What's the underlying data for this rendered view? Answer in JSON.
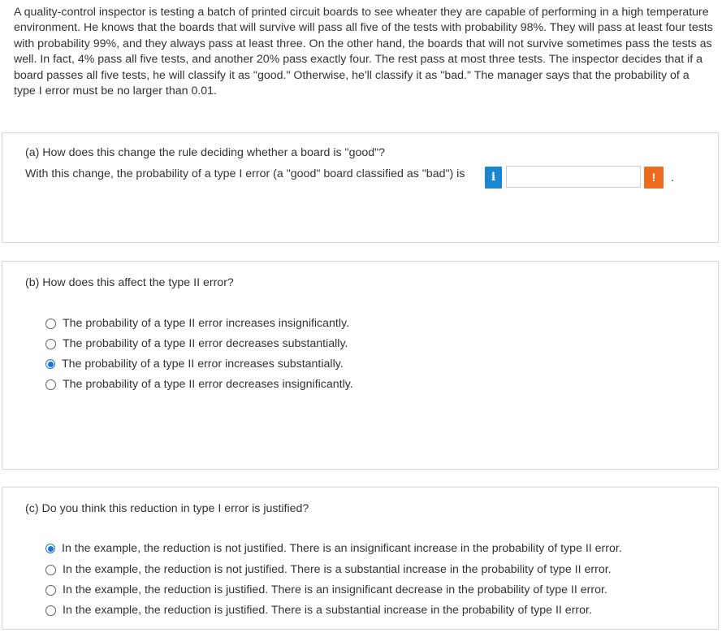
{
  "problem_text": "A quality-control inspector is testing a batch of printed circuit boards to see wheater they are capable of performing in a high temperature environment. He knows that the boards that will survive will pass all five of the tests with probability 98%. They will pass at least four tests with probability 99%, and they always pass at least three. On the other hand, the boards that will not survive sometimes pass the tests as well. In fact, 4% pass all five tests, and another 20% pass exactly four. The rest pass at most three tests. The inspector decides that if a board passes all five tests, he will classify it as \"good.\" Otherwise, he'll classify it as \"bad.\" The manager says that the probability of a type I error must be no larger than 0.01.",
  "part_a": {
    "question": "(a) How does this change the rule deciding whether a board is \"good\"?",
    "prompt": "With this change, the probability of a type I error (a \"good\" board classified as \"bad\") is",
    "info_glyph": "i",
    "answer_value": "",
    "alert_glyph": "!",
    "period": ".",
    "info_color": "#1a86d0",
    "alert_color": "#f06a1d"
  },
  "part_b": {
    "question": "(b) How does this affect the type II error?",
    "options": [
      {
        "label": "The probability of a type II error increases insignificantly.",
        "selected": false
      },
      {
        "label": "The probability of a type II error decreases substantially.",
        "selected": false
      },
      {
        "label": "The probability of a type II error increases substantially.",
        "selected": true
      },
      {
        "label": "The probability of a type II error decreases insignificantly.",
        "selected": false
      }
    ]
  },
  "part_c": {
    "question": "(c) Do you think this reduction in type I error is justified?",
    "options": [
      {
        "label": "In the example, the reduction is not justified. There is an insignificant increase in the probability of type II error.",
        "selected": true
      },
      {
        "label": "In the example, the reduction is not justified. There is a substantial increase in the probability of type II error.",
        "selected": false
      },
      {
        "label": "In the example, the reduction is justified. There is an insignificant decrease in the probability of type II error.",
        "selected": false
      },
      {
        "label": "In the example, the reduction is justified. There is a substantial increase in the probability of type II error.",
        "selected": false
      }
    ]
  },
  "radio_selected_color": "#1a73d9"
}
